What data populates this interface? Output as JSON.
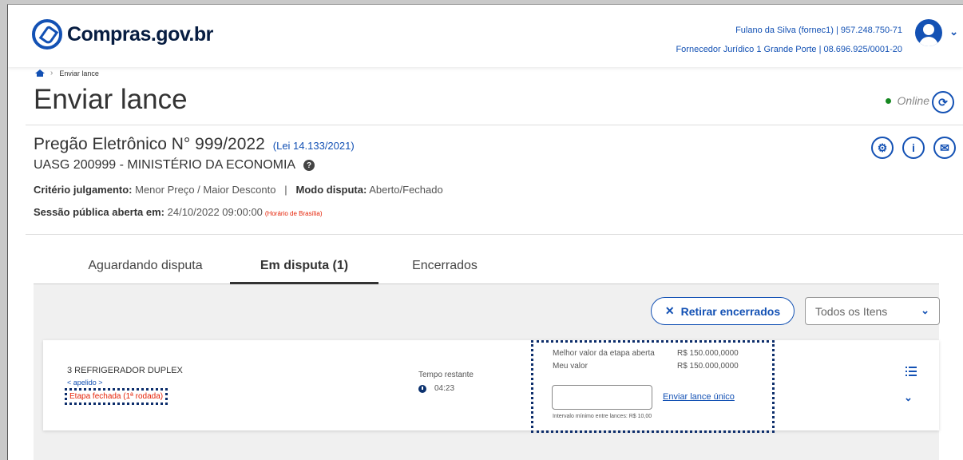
{
  "header": {
    "logo_text": "Compras.gov.br",
    "user_line1": "Fulano da Silva (fornec1) | 957.248.750-71",
    "user_line2": "Fornecedor Jurídico 1 Grande Porte | 08.696.925/0001-20"
  },
  "breadcrumb": {
    "current": "Enviar lance"
  },
  "page": {
    "title": "Enviar lance",
    "status": "Online"
  },
  "pregao": {
    "title": "Pregão Eletrônico N° 999/2022",
    "lei": "(Lei 14.133/2021)",
    "uasg": "UASG 200999 - MINISTÉRIO DA ECONOMIA",
    "criterio_label": "Critério julgamento:",
    "criterio_value": " Menor Preço / Maior Desconto",
    "separator": "|",
    "modo_label": "Modo disputa:",
    "modo_value": " Aberto/Fechado",
    "sessao_label": "Sessão pública aberta em:",
    "sessao_value": " 24/10/2022 09:00:00",
    "horario": "(Horário de Brasília)"
  },
  "tabs": [
    {
      "label": "Aguardando disputa"
    },
    {
      "label": "Em disputa (1)"
    },
    {
      "label": "Encerrados"
    }
  ],
  "toolbar": {
    "retirar_label": "Retirar encerrados",
    "filter_selected": "Todos os Itens"
  },
  "item": {
    "title": "3  REFRIGERADOR DUPLEX",
    "apelido": "< apelido >",
    "etapa": "Etapa fechada (1ª rodada)",
    "tempo_label": "Tempo restante",
    "tempo_value": "04:23",
    "melhor_label": "Melhor valor da etapa aberta",
    "melhor_value": "R$ 150.000,0000",
    "meu_label": "Meu valor",
    "meu_value": "R$ 150.000,0000",
    "lance_input_value": "",
    "enviar_label": "Enviar lance único",
    "intervalo": "Intervalo mínimo entre lances: R$ 10,00"
  },
  "colors": {
    "primary": "#1351b4",
    "online": "#168821",
    "danger": "#e52207",
    "highlight": "#0c2d6b"
  }
}
